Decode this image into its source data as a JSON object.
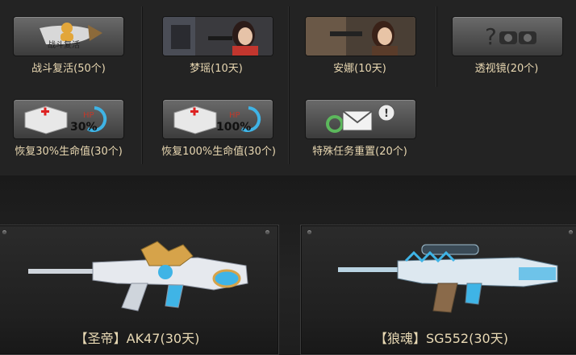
{
  "items": [
    {
      "label": "战斗复活(50个)",
      "icon": "revive-icon",
      "icon_text": "战斗复活"
    },
    {
      "label": "梦瑶(10天)",
      "icon": "character-portrait-mengyao"
    },
    {
      "label": "安娜(10天)",
      "icon": "character-portrait-anna"
    },
    {
      "label": "透视镜(20个)",
      "icon": "binoculars-icon"
    },
    {
      "label": "恢复30%生命值(30个)",
      "icon": "medkit-icon",
      "hp_label": "HP",
      "hp_value": "30%"
    },
    {
      "label": "恢复100%生命值(30个)",
      "icon": "medkit-icon",
      "hp_label": "HP",
      "hp_value": "100%"
    },
    {
      "label": "特殊任务重置(20个)",
      "icon": "mission-reset-icon"
    }
  ],
  "weapons": [
    {
      "label": "【圣帝】AK47(30天)",
      "icon": "ak47-rifle-icon"
    },
    {
      "label": "【狼魂】SG552(30天)",
      "icon": "sg552-rifle-icon"
    }
  ],
  "colors": {
    "label": "#e9d8b2",
    "panel_border": "#3c3c3c",
    "accent_blue": "#3fb4e6",
    "accent_gold": "#d6a34a"
  }
}
